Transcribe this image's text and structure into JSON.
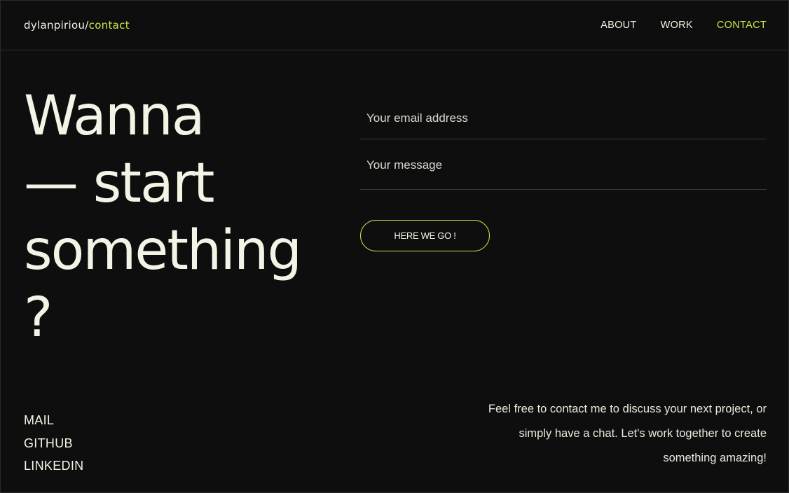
{
  "header": {
    "logo_name": "dylanpiriou",
    "logo_sep": "/",
    "logo_page": "contact",
    "nav": [
      {
        "label": "ABOUT"
      },
      {
        "label": "WORK"
      },
      {
        "label": "CONTACT",
        "active": true
      }
    ]
  },
  "hero": {
    "lines": [
      "Wanna",
      "— start",
      "something",
      "?"
    ]
  },
  "form": {
    "email_placeholder": "Your email address",
    "email_value": "",
    "message_placeholder": "Your message",
    "message_value": "",
    "submit_label": "HERE WE GO !"
  },
  "social": {
    "links": [
      "MAIL",
      "GITHUB",
      "LINKEDIN"
    ]
  },
  "blurb": {
    "text": "Feel free to contact me to discuss your next project, or simply have a chat. Let's work together to create something amazing!"
  },
  "colors": {
    "background": "#0e0e0e",
    "text": "#f3f3e6",
    "accent": "#c6e84a"
  }
}
